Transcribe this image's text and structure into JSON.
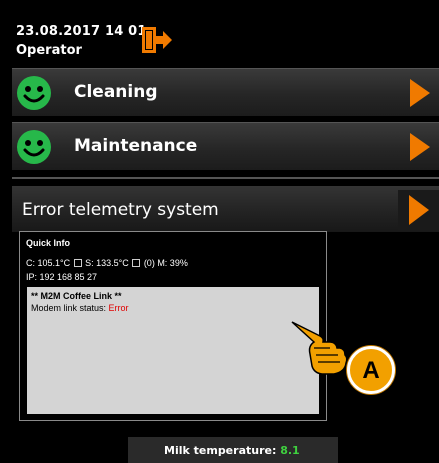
{
  "header": {
    "datetime": "23.08.2017 14 01",
    "user": "Operator",
    "logout_icon": "logout-door-icon"
  },
  "menu": [
    {
      "label": "Cleaning",
      "status_icon": "smiley-ok-icon",
      "arrow_icon": "arrow-right-icon"
    },
    {
      "label": "Maintenance",
      "status_icon": "smiley-ok-icon",
      "arrow_icon": "arrow-right-icon"
    }
  ],
  "error_telemetry": {
    "label": "Error telemetry system",
    "arrow_icon": "arrow-right-icon"
  },
  "quick_info": {
    "title": "Quick Info",
    "line1_a": "C: 105.1°C",
    "line1_b": "S: 133.5°C",
    "line1_c": "(0)   M: 39%",
    "line2": "IP: 192 168 85 27",
    "m2m_title": "** M2M Coffee Link **",
    "m2m_status_label": "Modem link status:",
    "m2m_status_value": "Error"
  },
  "callout": {
    "letter": "A",
    "pointer_icon": "pointing-hand-icon"
  },
  "milk": {
    "label": "Milk temperature:",
    "value": "8.1"
  },
  "colors": {
    "accent_orange": "#f07a00",
    "ok_green": "#27b84a",
    "error_red": "#e00000",
    "value_green": "#3fd03f"
  }
}
